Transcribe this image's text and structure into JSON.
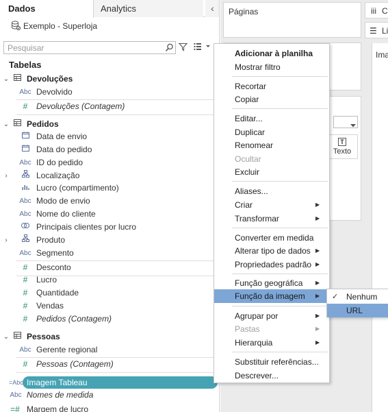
{
  "tabs": {
    "data": "Dados",
    "analytics": "Analytics"
  },
  "data_source": {
    "name": "Exemplo - Superloja"
  },
  "search": {
    "placeholder": "Pesquisar"
  },
  "tables_heading": "Tabelas",
  "tables": {
    "devolucoes": {
      "label": "Devoluções",
      "fields": [
        {
          "type": "Abc",
          "label": "Devolvido"
        },
        {
          "type": "#",
          "label": "Devoluções (Contagem)"
        }
      ]
    },
    "pedidos": {
      "label": "Pedidos",
      "fields": [
        {
          "type": "date",
          "label": "Data de envio"
        },
        {
          "type": "date",
          "label": "Data do pedido"
        },
        {
          "type": "Abc",
          "label": "ID do pedido"
        },
        {
          "type": "hierarchy",
          "label": "Localização"
        },
        {
          "type": "bin",
          "label": "Lucro (compartimento)"
        },
        {
          "type": "Abc",
          "label": "Modo de envio"
        },
        {
          "type": "Abc",
          "label": "Nome do cliente"
        },
        {
          "type": "set",
          "label": "Principais clientes por lucro"
        },
        {
          "type": "hierarchy",
          "label": "Produto"
        },
        {
          "type": "Abc",
          "label": "Segmento"
        },
        {
          "type": "#",
          "label": "Desconto"
        },
        {
          "type": "#",
          "label": "Lucro"
        },
        {
          "type": "#",
          "label": "Quantidade"
        },
        {
          "type": "#",
          "label": "Vendas"
        },
        {
          "type": "#",
          "label": "Pedidos (Contagem)"
        }
      ]
    },
    "pessoas": {
      "label": "Pessoas",
      "fields": [
        {
          "type": "Abc",
          "label": "Gerente regional"
        },
        {
          "type": "#",
          "label": "Pessoas (Contagem)"
        }
      ]
    }
  },
  "extra_fields": {
    "imagem_type": "=Abc",
    "imagem": "Imagem Tableau",
    "nomes_type": "Abc",
    "nomes": "Nomes de medida",
    "margem_type": "=#",
    "margem": "Margem de lucro"
  },
  "cards": {
    "paginas": "Páginas",
    "texto": "Texto"
  },
  "right_cards": {
    "cols": "Co",
    "rows": "Li",
    "sheet": "Ima"
  },
  "menu": {
    "items": [
      "Adicionar à planilha",
      "Mostrar filtro",
      "Recortar",
      "Copiar",
      "Editar...",
      "Duplicar",
      "Renomear",
      "Ocultar",
      "Excluir",
      "Aliases...",
      "Criar",
      "Transformar",
      "Converter em medida",
      "Alterar tipo de dados",
      "Propriedades padrão",
      "Função geográfica",
      "Função da imagem",
      "Agrupar por",
      "Pastas",
      "Hierarquia",
      "Substituir referências...",
      "Descrever..."
    ]
  },
  "submenu": {
    "items": [
      "Nenhum",
      "URL"
    ],
    "checked": "Nenhum",
    "highlighted": "URL"
  },
  "colors": {
    "accent_selection": "#7da6d7",
    "pill": "#46a3b4",
    "measure_green": "#2d8a73",
    "dimension_blue": "#5b6f9a"
  }
}
